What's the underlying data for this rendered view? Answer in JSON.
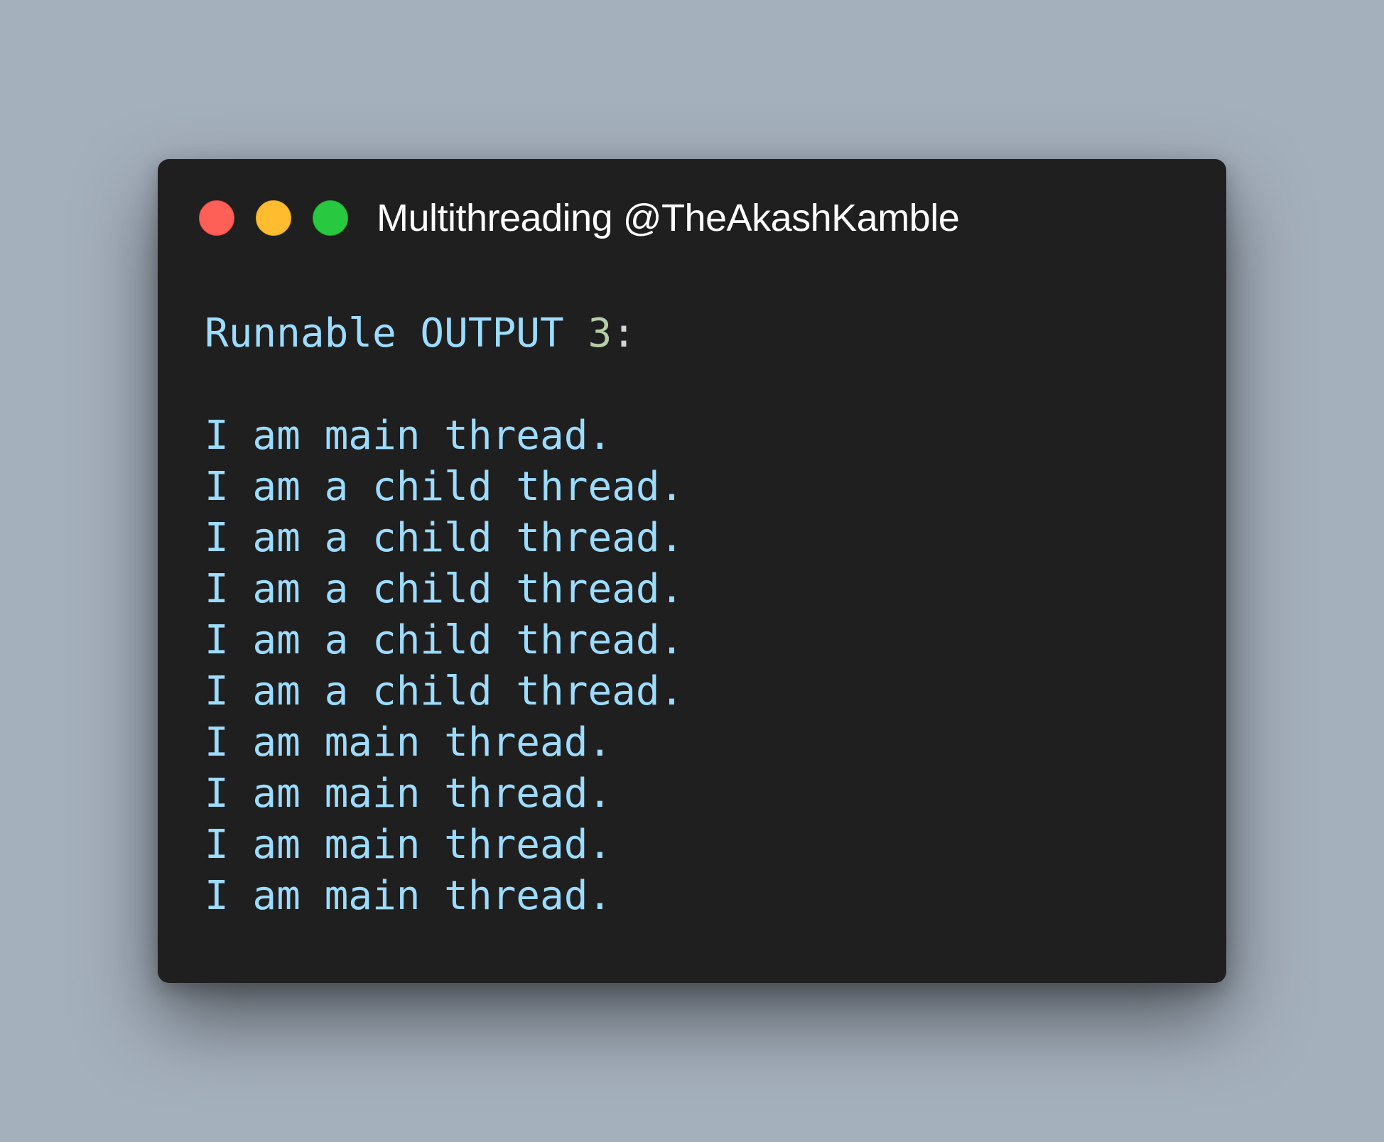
{
  "window": {
    "title": "Multithreading @TheAkashKamble",
    "controls": [
      {
        "name": "close",
        "color": "#fe5f57"
      },
      {
        "name": "minimize",
        "color": "#febc2e"
      },
      {
        "name": "maximize",
        "color": "#28c840"
      }
    ]
  },
  "code": {
    "heading": {
      "words": "Runnable OUTPUT ",
      "number": "3",
      "colon": ":"
    },
    "lines": [
      "I am main thread.",
      "I am a child thread.",
      "I am a child thread.",
      "I am a child thread.",
      "I am a child thread.",
      "I am a child thread.",
      "I am main thread.",
      "I am main thread.",
      "I am main thread.",
      "I am main thread."
    ]
  },
  "colors": {
    "background": "#a5b0bd",
    "window": "#1f1f1f",
    "text": "#9cdcfe",
    "number": "#b5cea8"
  }
}
